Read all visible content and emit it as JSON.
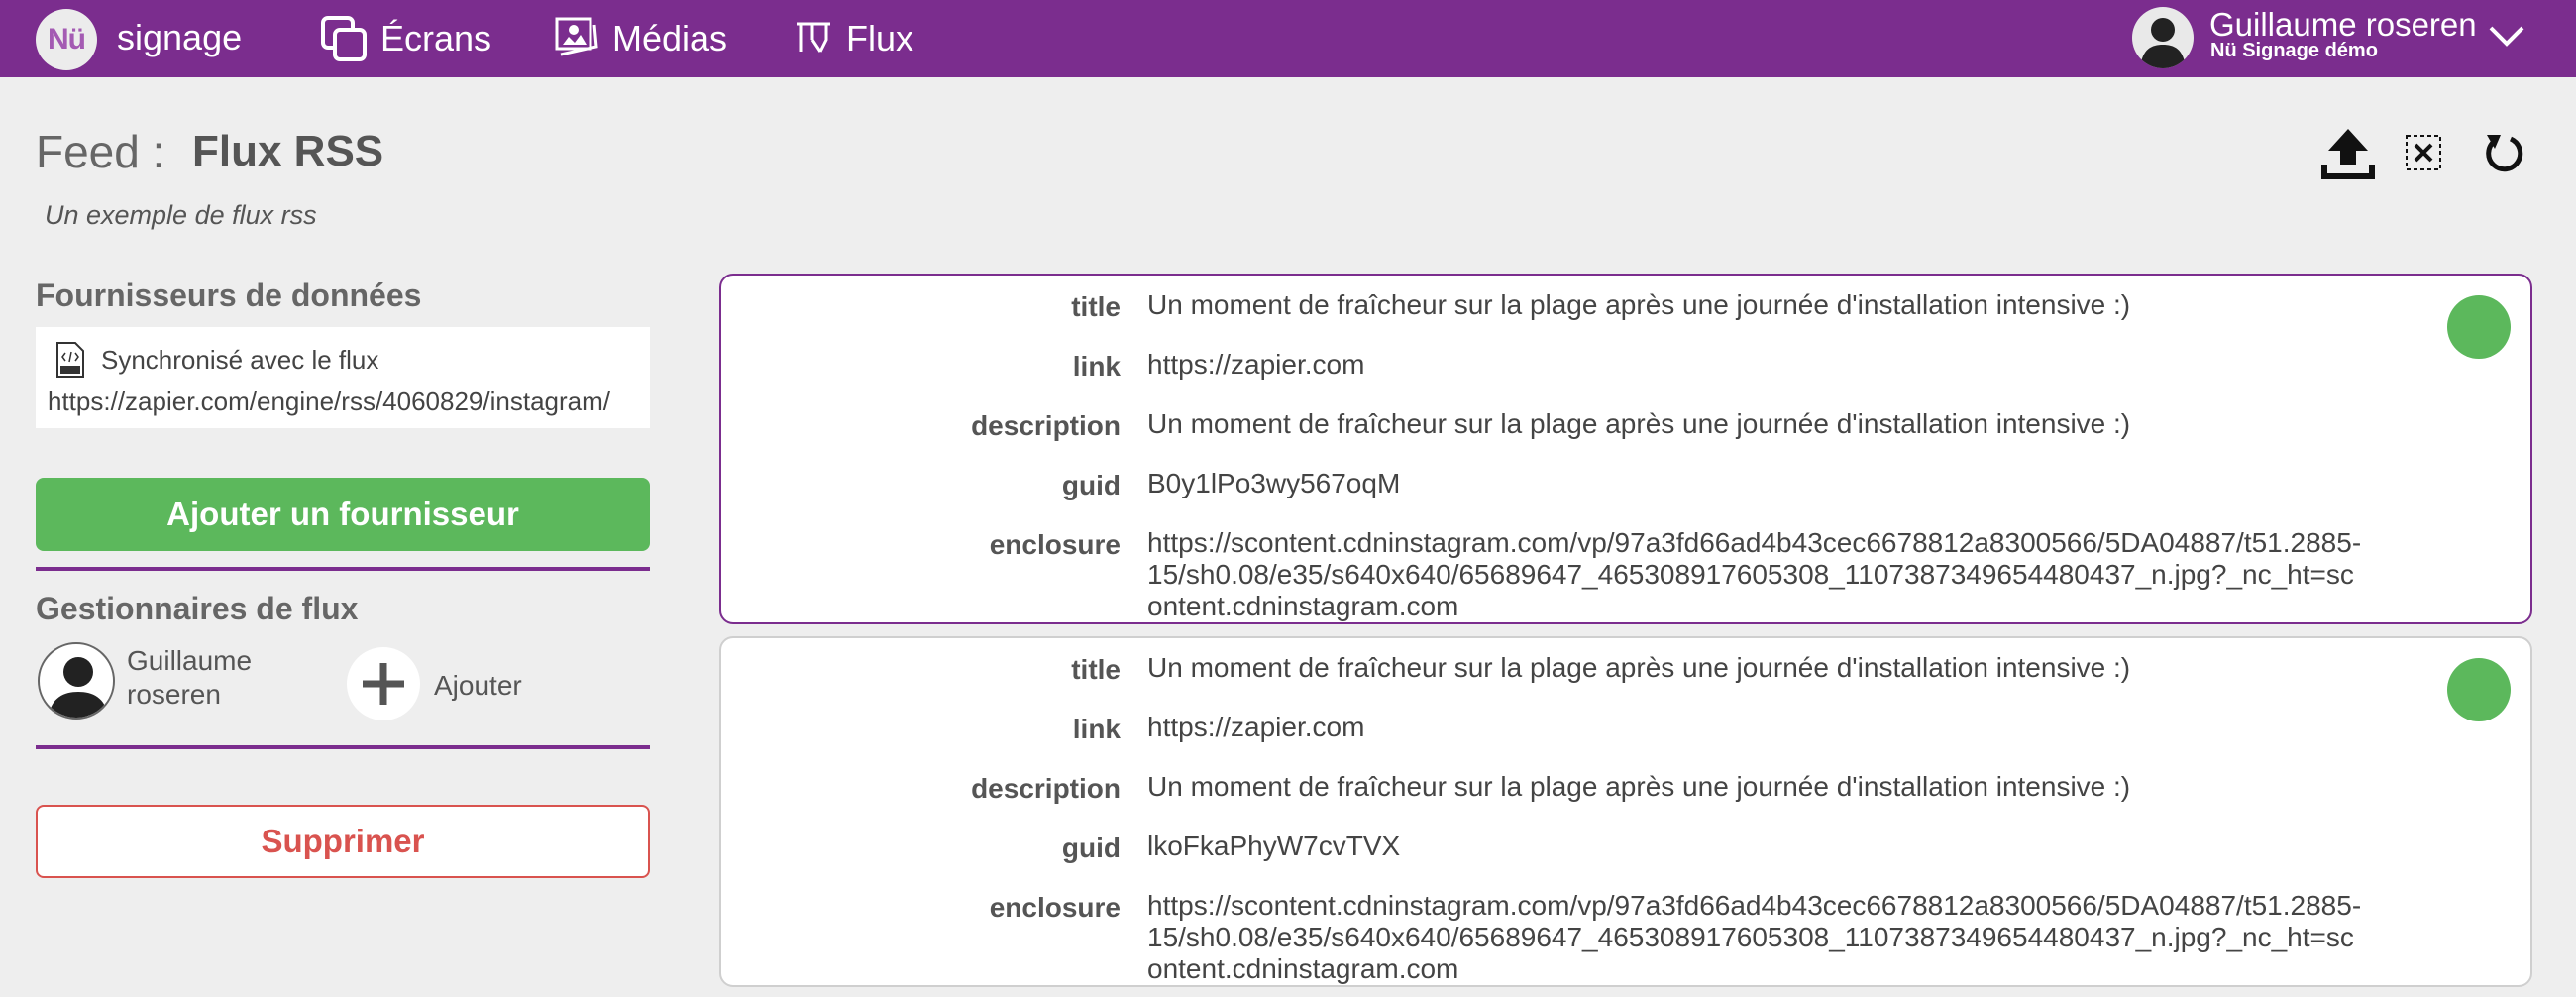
{
  "app": {
    "logo_text": "Nü",
    "brand": "signage",
    "nav": [
      {
        "label": "Écrans",
        "icon": "screens-icon"
      },
      {
        "label": "Médias",
        "icon": "media-icon"
      },
      {
        "label": "Flux",
        "icon": "flux-icon"
      }
    ],
    "user": {
      "name": "Guillaume roseren",
      "org": "Nü Signage démo"
    },
    "colors": {
      "brand": "#7b2d8e",
      "success": "#5cb85c",
      "danger": "#d9534f",
      "background": "#eeeeee"
    }
  },
  "header": {
    "feed_label": "Feed :",
    "feed_name": "Flux RSS",
    "description": "Un exemple de flux rss",
    "tools": [
      "upload-icon",
      "clear-icon",
      "refresh-icon"
    ]
  },
  "providers": {
    "title": "Fournisseurs de données",
    "sync_label": "Synchronisé avec le flux",
    "url": "https://zapier.com/engine/rss/4060829/instagram/",
    "add_button": "Ajouter un fournisseur"
  },
  "managers": {
    "title": "Gestionnaires de flux",
    "user_name": "Guillaume roseren",
    "add_label": "Ajouter"
  },
  "delete_button": "Supprimer",
  "items": [
    {
      "status": "active",
      "fields": [
        {
          "key": "title",
          "value": "Un moment de fraîcheur sur la plage après une journée d'installation intensive :)"
        },
        {
          "key": "link",
          "value": "https://zapier.com"
        },
        {
          "key": "description",
          "value": "Un moment de fraîcheur sur la plage après une journée d'installation intensive :)"
        },
        {
          "key": "guid",
          "value": "B0y1lPo3wy567oqM"
        },
        {
          "key": "enclosure",
          "value": "https://scontent.cdninstagram.com/vp/97a3fd66ad4b43cec6678812a8300566/5DA04887/t51.2885-15/sh0.08/e35/s640x640/65689647_465308917605308_1107387349654480437_n.jpg?_nc_ht=scontent.cdninstagram.com"
        }
      ]
    },
    {
      "status": "active",
      "fields": [
        {
          "key": "title",
          "value": "Un moment de fraîcheur sur la plage après une journée d'installation intensive :)"
        },
        {
          "key": "link",
          "value": "https://zapier.com"
        },
        {
          "key": "description",
          "value": "Un moment de fraîcheur sur la plage après une journée d'installation intensive :)"
        },
        {
          "key": "guid",
          "value": "lkoFkaPhyW7cvTVX"
        },
        {
          "key": "enclosure",
          "value": "https://scontent.cdninstagram.com/vp/97a3fd66ad4b43cec6678812a8300566/5DA04887/t51.2885-15/sh0.08/e35/s640x640/65689647_465308917605308_1107387349654480437_n.jpg?_nc_ht=scontent.cdninstagram.com"
        }
      ]
    }
  ]
}
